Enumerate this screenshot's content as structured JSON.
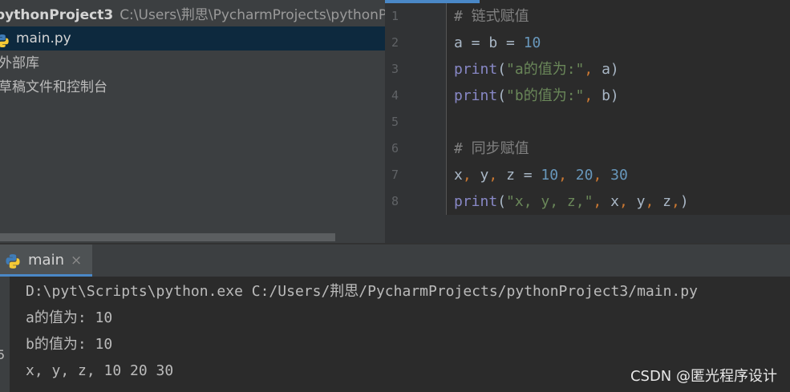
{
  "project_panel": {
    "root_name": "pythonProject3",
    "root_path": "C:\\Users\\荆思\\PycharmProjects\\pythonP",
    "items": [
      {
        "label": "main.py"
      },
      {
        "label": "外部库"
      },
      {
        "label": "草稿文件和控制台"
      }
    ]
  },
  "editor": {
    "lines": [
      {
        "n": "1"
      },
      {
        "n": "2"
      },
      {
        "n": "3"
      },
      {
        "n": "4"
      },
      {
        "n": "5"
      },
      {
        "n": "6"
      },
      {
        "n": "7"
      },
      {
        "n": "8"
      }
    ],
    "tokens": {
      "l1_comment": "# 链式赋值",
      "l2_a": "a",
      "l2_eq1": " = ",
      "l2_b": "b",
      "l2_eq2": " = ",
      "l2_num": "10",
      "l3_print": "print",
      "l3_open": "(",
      "l3_str": "\"a的值为:\"",
      "l3_comma": ", ",
      "l3_arg": "a",
      "l3_close": ")",
      "l4_print": "print",
      "l4_open": "(",
      "l4_str": "\"b的值为:\"",
      "l4_comma": ", ",
      "l4_arg": "b",
      "l4_close": ")",
      "l6_comment": "# 同步赋值",
      "l7_x": "x",
      "l7_c1": ", ",
      "l7_y": "y",
      "l7_c2": ", ",
      "l7_z": "z",
      "l7_eq": " = ",
      "l7_n1": "10",
      "l7_c3": ", ",
      "l7_n2": "20",
      "l7_c4": ", ",
      "l7_n3": "30",
      "l8_print": "print",
      "l8_open": "(",
      "l8_str": "\"x, y, z,\"",
      "l8_c1": ", ",
      "l8_x": "x",
      "l8_c2": ", ",
      "l8_y": "y",
      "l8_c3": ", ",
      "l8_z": "z",
      "l8_c4": ",",
      "l8_close": ")"
    }
  },
  "run_panel": {
    "tab_label": "main",
    "close_glyph": "×",
    "left_glyph": "5",
    "console_lines": [
      "D:\\pyt\\Scripts\\python.exe C:/Users/荆思/PycharmProjects/pythonProject3/main.py",
      "a的值为: 10",
      "b的值为: 10",
      "x, y, z, 10 20 30"
    ]
  },
  "watermark": "CSDN @匿光程序设计",
  "icons": {
    "python_file": "python-file-icon",
    "python_run": "python-icon",
    "close": "close-icon"
  },
  "colors": {
    "accent": "#4a88c7",
    "selection": "#0d293e",
    "string": "#6a8759",
    "number": "#6897bb",
    "builtin": "#8888c6",
    "punctuation": "#cc7832",
    "comment": "#808080"
  }
}
